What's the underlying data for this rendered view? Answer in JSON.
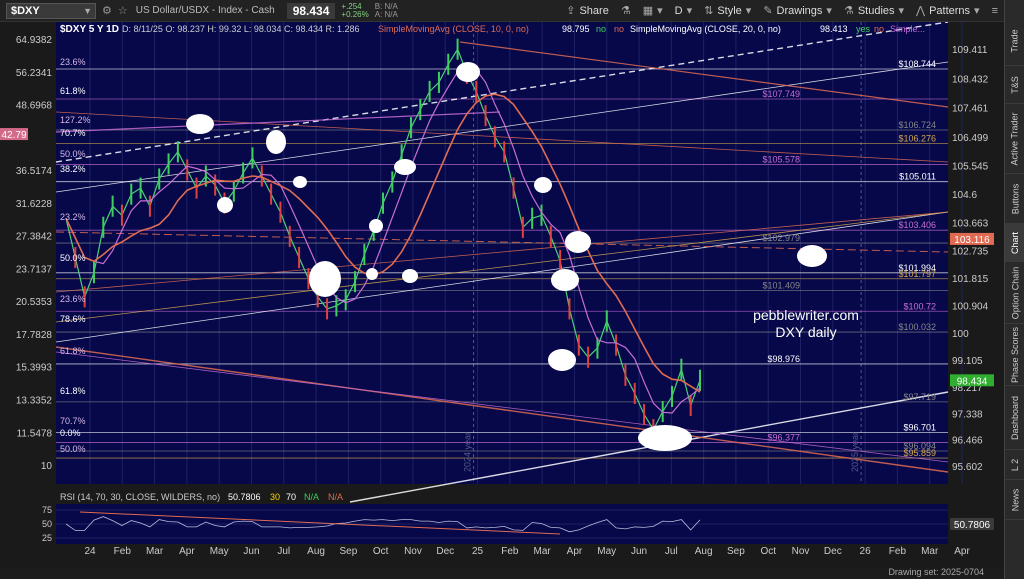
{
  "toolbar": {
    "symbol": "$DXY",
    "instrument_name": "US Dollar/USDX - Index - Cash",
    "last_price": "98.434",
    "change_abs": "+.254",
    "change_pct": "+0.26%",
    "bid": "B: N/A",
    "ask": "A: N/A",
    "share": "Share",
    "period": "D",
    "style": "Style",
    "drawings": "Drawings",
    "studies": "Studies",
    "patterns": "Patterns"
  },
  "chart_header": {
    "title": "$DXY 5 Y 1D",
    "ohlc": "D: 8/11/25  O: 98.237  H: 99.32  L: 98.034  C: 98.434  R: 1.286",
    "sma10": "SimpleMovingAvg (CLOSE, 10, 0, no)",
    "sma10_val": "98.795",
    "sma10_f1": "no",
    "sma10_f2": "no",
    "sma20": "SimpleMovingAvg (CLOSE, 20, 0, no)",
    "sma20_val": "98.413",
    "sma20_f1": "yes",
    "sma20_f2": "no",
    "sma_more": "Simple..."
  },
  "right_tabs": [
    "Trade",
    "T&S",
    "Active Trader",
    "Buttons",
    "Chart",
    "Option Chain",
    "Phase Scores",
    "Dashboard",
    "L 2",
    "News"
  ],
  "chart_data": {
    "type": "line",
    "y_scale": "log",
    "ylim": [
      9.2,
      70
    ],
    "right_axis_range": [
      95.0,
      110.3
    ],
    "ticks_left": [
      "64.9382",
      "56.2341",
      "48.6968",
      "42.79",
      "36.5174",
      "31.6228",
      "27.3842",
      "23.7137",
      "20.5353",
      "17.7828",
      "15.3993",
      "13.3352",
      "11.5478",
      "10"
    ],
    "ticks_right": [
      "109.411",
      "108.432",
      "107.461",
      "106.499",
      "105.545",
      "104.6",
      "103.663",
      "102.735",
      "101.815",
      "100.904",
      "100",
      "99.105",
      "98.217",
      "97.338",
      "96.466",
      "95.602"
    ],
    "x_ticks": [
      "24",
      "Feb",
      "Mar",
      "Apr",
      "May",
      "Jun",
      "Jul",
      "Aug",
      "Sep",
      "Oct",
      "Nov",
      "Dec",
      "25",
      "Feb",
      "Mar",
      "Apr",
      "May",
      "Jun",
      "Jul",
      "Aug",
      "Sep",
      "Oct",
      "Nov",
      "Dec",
      "26",
      "Feb",
      "Mar",
      "Apr"
    ],
    "year_markers": [
      "2024 year",
      "2025 year"
    ],
    "price_badges": {
      "last": "98.434",
      "sma": "103.116",
      "left": "42.79"
    },
    "fib_left": [
      "23.6%",
      "61.8%",
      "127.2%",
      "70.7%",
      "50.0%",
      "38.2%",
      "23.2%",
      "50.0%",
      "23.6%",
      "78.6%",
      "61.8%",
      "61.8%",
      "70.7%",
      "0.0%",
      "50.0%"
    ],
    "level_labels": [
      "$108.744",
      "$107.749",
      "$106.724",
      "$106.276",
      "$105.578",
      "$105.011",
      "$103.406",
      "$102.979",
      "$101.994",
      "$101.797",
      "$101.409",
      "$100.72",
      "$100.032",
      "$98.976",
      "$97.719",
      "$96.701",
      "$96.377",
      "$96.094",
      "$95.859"
    ],
    "price_series": [
      103.8,
      102.5,
      101.2,
      102.0,
      103.5,
      104.2,
      103.9,
      104.6,
      104.8,
      104.2,
      105.1,
      105.6,
      106.0,
      105.4,
      104.8,
      105.2,
      104.9,
      104.3,
      104.7,
      105.3,
      105.8,
      105.2,
      104.6,
      104.0,
      103.2,
      102.5,
      101.8,
      101.2,
      100.8,
      100.9,
      101.1,
      101.7,
      102.6,
      103.4,
      104.3,
      105.0,
      105.9,
      106.8,
      107.4,
      108.0,
      108.3,
      108.9,
      109.4,
      108.6,
      108.0,
      107.2,
      106.5,
      106.0,
      104.8,
      103.5,
      103.8,
      103.9,
      103.2,
      102.4,
      100.8,
      99.6,
      99.2,
      99.5,
      100.4,
      99.6,
      98.6,
      98.0,
      97.3,
      96.8,
      97.4,
      97.9,
      98.8,
      97.6,
      98.434
    ],
    "annotation": [
      "pebblewriter.com",
      "DXY daily"
    ],
    "rsi": {
      "label": "RSI (14, 70, 30, CLOSE, WILDERS, no)",
      "value": "50.7806",
      "ob": "30",
      "os": "70",
      "na1": "N/A",
      "na2": "N/A",
      "ticks": [
        "75",
        "50",
        "25"
      ]
    }
  },
  "status": {
    "drawing_set": "Drawing set: 2025-0704"
  }
}
